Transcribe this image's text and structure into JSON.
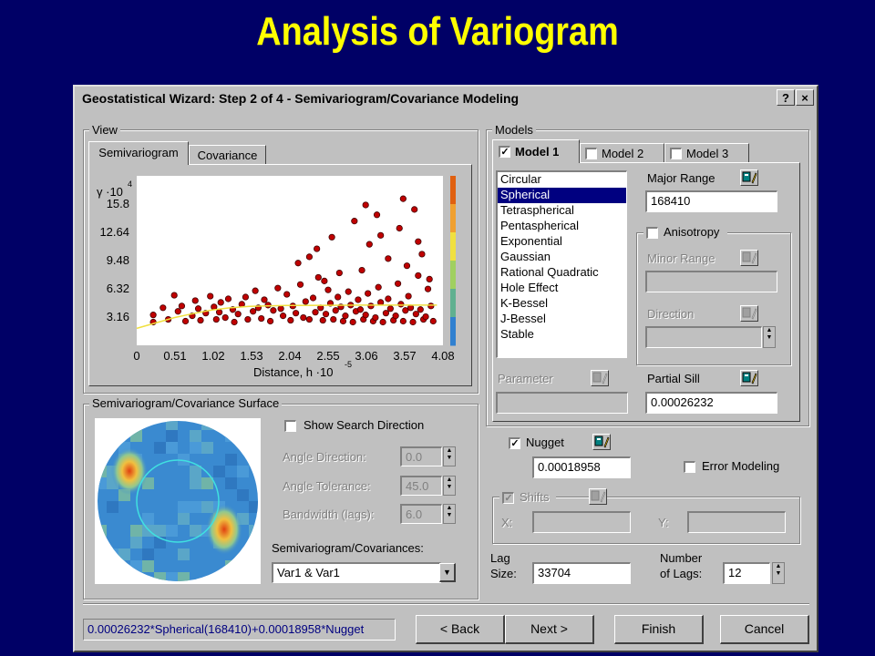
{
  "slide_title": "Analysis of Variogram",
  "dialog": {
    "title": "Geostatistical Wizard: Step 2 of 4 - Semivariogram/Covariance Modeling",
    "help_label": "?",
    "close_label": "×"
  },
  "view": {
    "group_label": "View",
    "tabs": [
      "Semivariogram",
      "Covariance"
    ],
    "active_tab": "Semivariogram"
  },
  "chart_data": {
    "type": "scatter",
    "title": "",
    "ylabel": "γ ·10",
    "ylabel_exponent": "4",
    "xlabel": "Distance, h ·10",
    "xlabel_exponent": "-5",
    "xlim": [
      0,
      4.08
    ],
    "ylim": [
      0,
      18.96
    ],
    "x_ticks": [
      "0",
      "0.51",
      "1.02",
      "1.53",
      "2.04",
      "2.55",
      "3.06",
      "3.57",
      "4.08"
    ],
    "y_ticks": [
      "3.16",
      "6.32",
      "9.48",
      "12.64",
      "15.8"
    ],
    "color_bar": [
      "#E06010",
      "#F0A030",
      "#F0E040",
      "#A0D060",
      "#60B090",
      "#3080D0"
    ],
    "series": [
      {
        "mark": "point",
        "color": "#C00000",
        "x": [
          0.22,
          0.22,
          0.35,
          0.42,
          0.5,
          0.55,
          0.6,
          0.65,
          0.74,
          0.78,
          0.82,
          0.85,
          0.92,
          0.98,
          1.03,
          1.06,
          1.1,
          1.12,
          1.18,
          1.22,
          1.28,
          1.3,
          1.35,
          1.4,
          1.45,
          1.48,
          1.55,
          1.58,
          1.62,
          1.66,
          1.7,
          1.75,
          1.78,
          1.82,
          1.88,
          1.92,
          1.95,
          2.0,
          2.05,
          2.08,
          2.12,
          2.18,
          2.22,
          2.25,
          2.3,
          2.35,
          2.38,
          2.42,
          2.45,
          2.48,
          2.52,
          2.55,
          2.58,
          2.62,
          2.65,
          2.68,
          2.72,
          2.75,
          2.78,
          2.82,
          2.85,
          2.88,
          2.92,
          2.95,
          2.98,
          3.02,
          3.05,
          3.08,
          3.12,
          3.15,
          3.18,
          3.22,
          3.25,
          3.28,
          3.32,
          3.35,
          3.38,
          3.42,
          3.45,
          3.48,
          3.52,
          3.55,
          3.58,
          3.62,
          3.65,
          3.68,
          3.72,
          3.75,
          3.78,
          3.82,
          3.85,
          3.88,
          3.92,
          3.95,
          2.15,
          2.4,
          2.6,
          2.9,
          3.0,
          3.1,
          3.2,
          3.35,
          3.5,
          3.6,
          3.7,
          3.8,
          3.9,
          3.25,
          3.55,
          3.75,
          2.7,
          3.05,
          2.3,
          2.5
        ],
        "y": [
          2.6,
          3.4,
          4.2,
          2.9,
          5.6,
          3.8,
          4.4,
          2.7,
          3.3,
          5.0,
          4.1,
          2.8,
          3.6,
          5.5,
          4.3,
          2.9,
          3.7,
          4.8,
          3.1,
          5.2,
          4.0,
          2.6,
          3.5,
          4.6,
          5.4,
          2.9,
          3.8,
          6.1,
          4.2,
          3.0,
          5.1,
          4.5,
          2.7,
          3.9,
          6.4,
          4.1,
          3.3,
          5.7,
          2.8,
          4.4,
          3.6,
          6.8,
          3.1,
          4.9,
          2.9,
          5.3,
          3.7,
          7.6,
          4.2,
          2.8,
          3.5,
          6.2,
          4.7,
          2.9,
          3.9,
          5.4,
          4.3,
          2.7,
          3.3,
          6.0,
          4.5,
          2.6,
          3.8,
          5.1,
          4.0,
          2.9,
          3.4,
          5.8,
          4.4,
          2.7,
          3.1,
          6.5,
          4.8,
          2.6,
          3.6,
          5.2,
          4.1,
          2.8,
          3.3,
          6.9,
          4.6,
          2.7,
          3.9,
          5.5,
          4.2,
          2.6,
          3.5,
          7.8,
          4.0,
          2.9,
          3.2,
          6.3,
          4.4,
          2.7,
          9.2,
          10.8,
          12.1,
          13.9,
          8.4,
          11.3,
          14.6,
          9.7,
          13.1,
          8.9,
          15.2,
          10.2,
          7.4,
          12.3,
          16.4,
          11.6,
          8.1,
          15.7,
          9.9,
          7.2
        ]
      },
      {
        "mark": "line",
        "name": "",
        "color": "#F0E040",
        "x": [
          0,
          0.25,
          0.5,
          0.75,
          1.0,
          1.25,
          1.5,
          1.75,
          2.0,
          2.5,
          3.0,
          3.5,
          4.0
        ],
        "y": [
          1.9,
          2.5,
          3.1,
          3.55,
          3.95,
          4.2,
          4.35,
          4.4,
          4.45,
          4.48,
          4.5,
          4.5,
          4.5
        ]
      }
    ]
  },
  "surface": {
    "group_label": "Semivariogram/Covariance Surface",
    "show_search_direction_label": "Show Search Direction",
    "show_search_direction_checked": false,
    "angle_direction_label": "Angle Direction:",
    "angle_direction_value": "0.0",
    "angle_tolerance_label": "Angle Tolerance:",
    "angle_tolerance_value": "45.0",
    "bandwidth_label": "Bandwidth (lags):",
    "bandwidth_value": "6.0",
    "covariances_label": "Semivariogram/Covariances:",
    "covariances_value": "Var1 & Var1"
  },
  "models": {
    "group_label": "Models",
    "tabs": [
      "Model 1",
      "Model 2",
      "Model 3"
    ],
    "tab_checked": [
      true,
      false,
      false
    ],
    "model_types": [
      "Circular",
      "Spherical",
      "Tetraspherical",
      "Pentaspherical",
      "Exponential",
      "Gaussian",
      "Rational Quadratic",
      "Hole Effect",
      "K-Bessel",
      "J-Bessel",
      "Stable"
    ],
    "selected_model": "Spherical",
    "major_range_label": "Major Range",
    "major_range_value": "168410",
    "anisotropy_label": "Anisotropy",
    "anisotropy_checked": false,
    "minor_range_label": "Minor Range",
    "direction_label": "Direction",
    "parameter_label": "Parameter",
    "partial_sill_label": "Partial Sill",
    "partial_sill_value": "0.00026232"
  },
  "nugget": {
    "label": "Nugget",
    "checked": true,
    "value": "0.00018958",
    "error_modeling_label": "Error Modeling",
    "error_modeling_checked": false
  },
  "shifts": {
    "label": "Shifts",
    "x_label": "X:",
    "y_label": "Y:"
  },
  "lag": {
    "lag_size_label_1": "Lag",
    "lag_size_label_2": "Size:",
    "lag_size_value": "33704",
    "num_lags_label_1": "Number",
    "num_lags_label_2": "of Lags:",
    "num_lags_value": "12"
  },
  "footer": {
    "formula": "0.00026232*Spherical(168410)+0.00018958*Nugget",
    "back_label": "< Back",
    "next_label": "Next >",
    "finish_label": "Finish",
    "cancel_label": "Cancel"
  }
}
